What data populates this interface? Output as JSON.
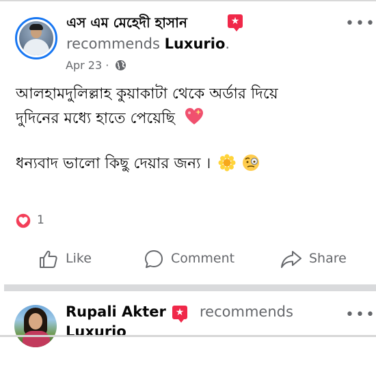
{
  "post1": {
    "author": "এস এম মেহেদী হাসান",
    "recommends_prefix": "recommends",
    "page_name": "Luxurio",
    "page_suffix": ".",
    "date": "Apr 23",
    "meta_sep": " · ",
    "privacy_icon": "globe-icon",
    "text_line1": "আলহামদুলিল্লাহ কুয়াকাটা থেকে অর্ডার দিয়ে",
    "text_line2": "দুদিনের মধ্যে হাতে পেয়েছি",
    "text_line3": "ধন্যবাদ ভালো কিছু দেয়ার জন্য ।",
    "reaction_icon": "love-reaction-icon",
    "reaction_count": "1",
    "actions": {
      "like": "Like",
      "comment": "Comment",
      "share": "Share"
    }
  },
  "post2": {
    "author": "Rupali Akter",
    "recommends_prefix": "recommends",
    "page_name": "Luxurio"
  },
  "colors": {
    "text_primary": "#050505",
    "text_secondary": "#65676b",
    "recommend_badge": "#f02849",
    "love_reaction": "#f33e58",
    "avatar_ring": "#1877f2",
    "separator": "#d9dadc"
  }
}
